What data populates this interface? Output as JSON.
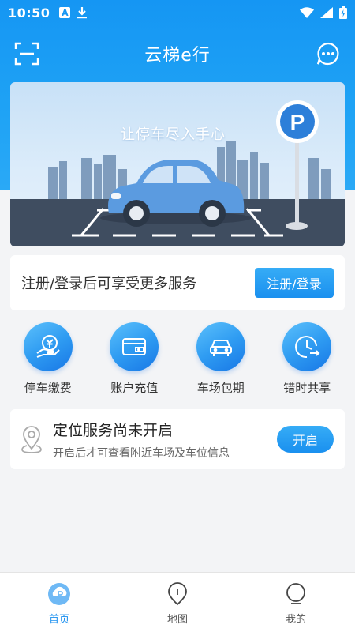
{
  "status_bar": {
    "time": "10:50",
    "notif_letter": "A"
  },
  "header": {
    "title": "云梯e行"
  },
  "banner": {
    "slogan": "让停车尽入手心",
    "sign_letter": "P"
  },
  "register_card": {
    "text": "注册/登录后可享受更多服务",
    "button": "注册/登录"
  },
  "actions": [
    {
      "label": "停车缴费",
      "icon": "parking-fee-icon"
    },
    {
      "label": "账户充值",
      "icon": "wallet-icon"
    },
    {
      "label": "车场包期",
      "icon": "car-icon"
    },
    {
      "label": "错时共享",
      "icon": "clock-share-icon"
    }
  ],
  "location_card": {
    "title": "定位服务尚未开启",
    "subtitle": "开启后才可查看附近车场及车位信息",
    "button": "开启"
  },
  "bottom_nav": [
    {
      "label": "首页",
      "icon": "home-icon",
      "active": true
    },
    {
      "label": "地图",
      "icon": "map-pin-icon",
      "active": false
    },
    {
      "label": "我的",
      "icon": "profile-icon",
      "active": false
    }
  ],
  "colors": {
    "primary": "#1a90ef",
    "header": "#1596f3",
    "background": "#f3f4f6"
  }
}
